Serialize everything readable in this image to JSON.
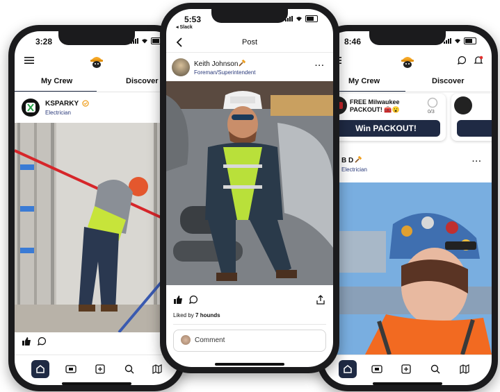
{
  "left_phone": {
    "status_time": "3:28",
    "tabs": [
      "My Crew",
      "Discover"
    ],
    "post": {
      "username": "KSPARKY",
      "role": "Electrician",
      "verified": true
    },
    "nav_icons": [
      "home-icon",
      "feed-icon",
      "add-icon",
      "search-icon",
      "map-icon"
    ]
  },
  "center_phone": {
    "status_time": "5:53",
    "back_app": "◂ Slack",
    "title": "Post",
    "post": {
      "username": "Keith Johnson",
      "role": "Foreman/Superintendent"
    },
    "liked_by_prefix": "Liked by ",
    "liked_by_count": "7 hounds",
    "comment_placeholder": "Comment"
  },
  "right_phone": {
    "status_time": "8:46",
    "tabs": [
      "My Crew",
      "Discover"
    ],
    "promo": {
      "text": "FREE Milwaukee PACKOUT! 🧰😮",
      "progress": "0/3",
      "button": "Win PACKOUT!"
    },
    "post": {
      "username": "B D",
      "role": "Electrician"
    },
    "nav_icons": [
      "home-icon",
      "feed-icon",
      "add-icon",
      "search-icon",
      "map-icon"
    ]
  },
  "colors": {
    "accent": "#1f2a44",
    "role_text": "#2a3a7a",
    "verified": "#f0a020"
  }
}
